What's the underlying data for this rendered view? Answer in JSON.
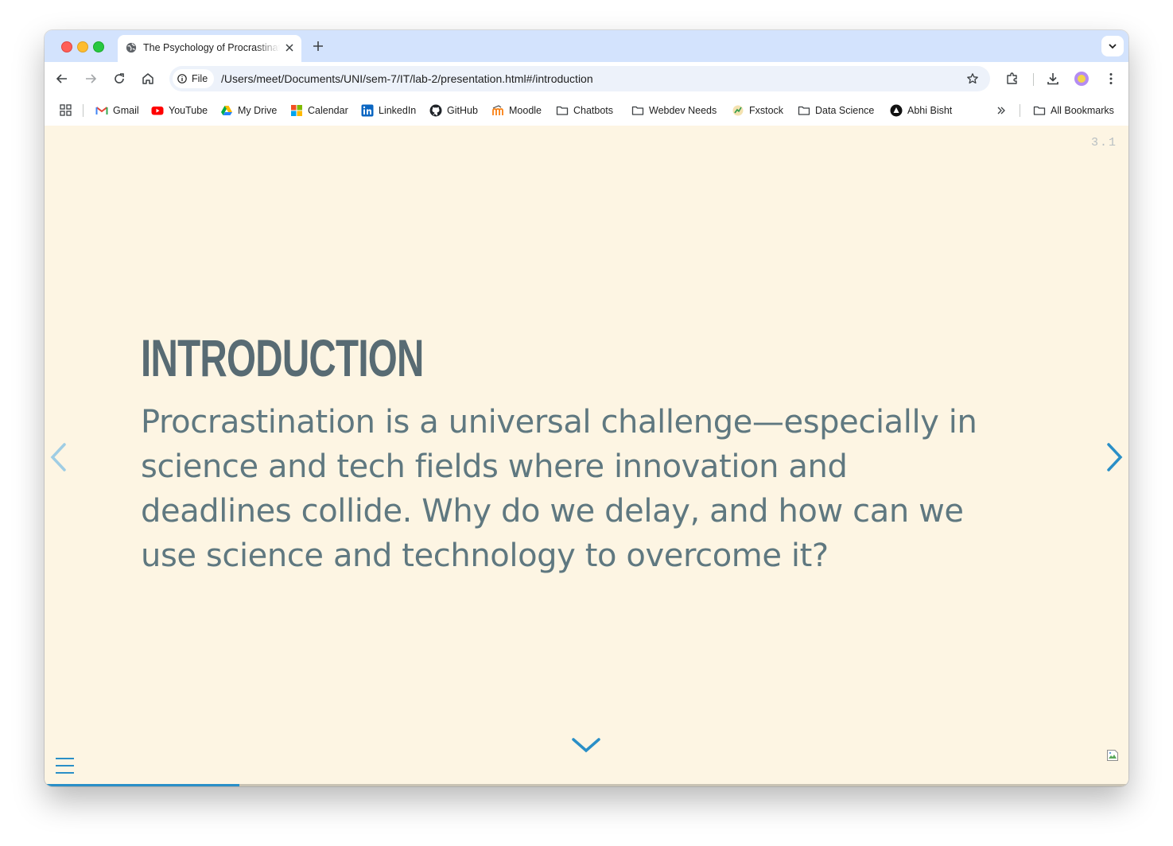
{
  "browser": {
    "tab": {
      "title": "The Psychology of Procrastination",
      "favicon": "globe-icon"
    },
    "address": {
      "chip_label": "File",
      "url": "/Users/meet/Documents/UNI/sem-7/IT/lab-2/presentation.html#/introduction"
    },
    "bookmarks": [
      {
        "label": "Gmail",
        "icon": "gmail-icon"
      },
      {
        "label": "YouTube",
        "icon": "youtube-icon"
      },
      {
        "label": "My Drive",
        "icon": "drive-icon"
      },
      {
        "label": "Calendar",
        "icon": "microsoft-icon"
      },
      {
        "label": "LinkedIn",
        "icon": "linkedin-icon"
      },
      {
        "label": "GitHub",
        "icon": "github-icon"
      },
      {
        "label": "Moodle",
        "icon": "moodle-icon"
      },
      {
        "label": "Chatbots",
        "icon": "folder-icon"
      },
      {
        "label": "Webdev Needs",
        "icon": "folder-icon"
      },
      {
        "label": "Fxstock",
        "icon": "fxstock-icon"
      },
      {
        "label": "Data Science",
        "icon": "folder-icon"
      },
      {
        "label": "Abhi Bisht",
        "icon": "abhi-icon"
      }
    ],
    "all_bookmarks_label": "All Bookmarks"
  },
  "slide": {
    "number": "3.1",
    "title": "Introduction",
    "body": "Procrastination is a universal challenge—especially in science and tech fields where innovation and deadlines collide. Why do we delay, and how can we use science and technology to overcome it?",
    "progress": 0.18
  },
  "colors": {
    "background": "#fdf5e3",
    "title": "#586b73",
    "body": "#5f7880",
    "accent": "#2a8fc7",
    "tabstrip": "#d3e3fd"
  }
}
